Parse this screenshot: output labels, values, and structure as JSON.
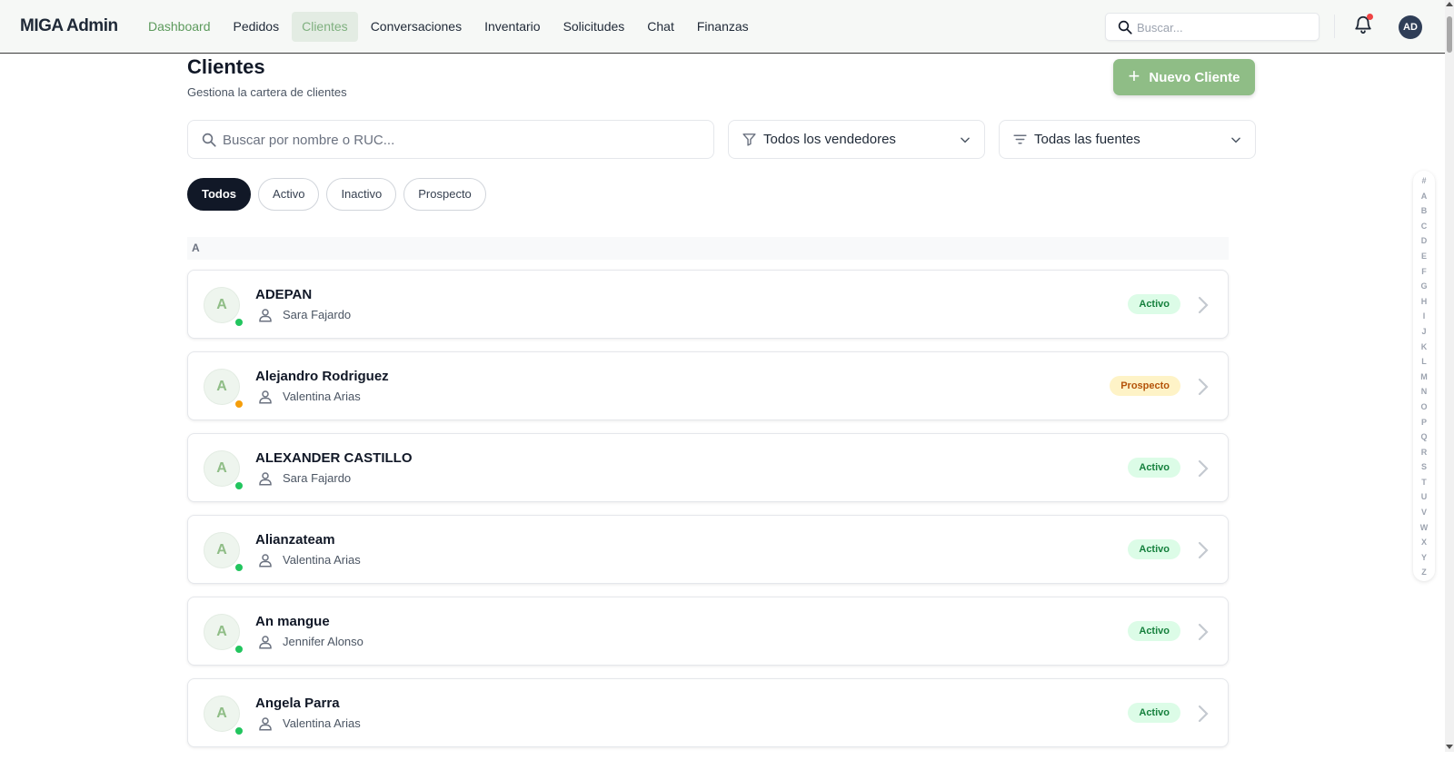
{
  "app": {
    "brand": "MIGA Admin"
  },
  "nav": {
    "items": [
      {
        "label": "Dashboard"
      },
      {
        "label": "Pedidos"
      },
      {
        "label": "Clientes"
      },
      {
        "label": "Conversaciones"
      },
      {
        "label": "Inventario"
      },
      {
        "label": "Solicitudes"
      },
      {
        "label": "Chat"
      },
      {
        "label": "Finanzas"
      }
    ],
    "active": "Clientes"
  },
  "topbar": {
    "search_placeholder": "Buscar...",
    "avatar_initials": "AD",
    "has_notification": true
  },
  "header": {
    "title": "Clientes",
    "subtitle": "Gestiona la cartera de clientes",
    "new_button_label": "Nuevo Cliente"
  },
  "filters": {
    "search_placeholder": "Buscar por nombre o RUC...",
    "vendor_select": "Todos los vendedores",
    "source_select": "Todas las fuentes"
  },
  "status_chips": [
    {
      "label": "Todos",
      "active": true
    },
    {
      "label": "Activo",
      "active": false
    },
    {
      "label": "Inactivo",
      "active": false
    },
    {
      "label": "Prospecto",
      "active": false
    }
  ],
  "section_letter": "A",
  "clients": [
    {
      "initial": "A",
      "name": "ADEPAN",
      "vendor": "Sara Fajardo",
      "status": "Activo",
      "status_color": "#22c55e"
    },
    {
      "initial": "A",
      "name": "Alejandro Rodriguez",
      "vendor": "Valentina Arias",
      "status": "Prospecto",
      "status_color": "#f59e0b"
    },
    {
      "initial": "A",
      "name": "ALEXANDER CASTILLO",
      "vendor": "Sara Fajardo",
      "status": "Activo",
      "status_color": "#22c55e"
    },
    {
      "initial": "A",
      "name": "Alianzateam",
      "vendor": "Valentina Arias",
      "status": "Activo",
      "status_color": "#22c55e"
    },
    {
      "initial": "A",
      "name": "An mangue",
      "vendor": "Jennifer Alonso",
      "status": "Activo",
      "status_color": "#22c55e"
    },
    {
      "initial": "A",
      "name": "Angela Parra",
      "vendor": "Valentina Arias",
      "status": "Activo",
      "status_color": "#22c55e"
    }
  ],
  "alphabet": [
    "#",
    "A",
    "B",
    "C",
    "D",
    "E",
    "F",
    "G",
    "H",
    "I",
    "J",
    "K",
    "L",
    "M",
    "N",
    "O",
    "P",
    "Q",
    "R",
    "S",
    "T",
    "U",
    "V",
    "W",
    "X",
    "Y",
    "Z"
  ],
  "colors": {
    "accent": "#8fbd86",
    "active_chip": "#111827",
    "active_badge_bg": "#dcfce7",
    "prospect_badge_bg": "#fef3c7"
  }
}
